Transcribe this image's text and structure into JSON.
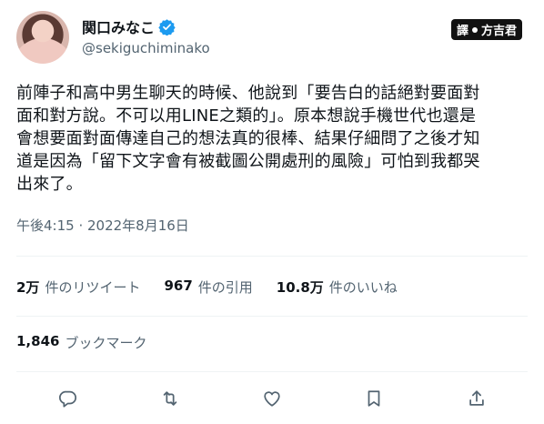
{
  "author": {
    "display_name": "関口みなこ",
    "handle": "@sekiguchiminako"
  },
  "watermark": {
    "left": "譯",
    "right": "方吉君"
  },
  "tweet": {
    "lines": [
      "前陣子和高中男生聊天的時候、他說到「要告白的話絕對要面對",
      "面和對方說。不可以用LINE之類的」。原本想說手機世代也還是",
      "會想要面對面傳達自己的想法真的很棒、結果仔細問了之後才知",
      "道是因為「留下文字會有被截圖公開處刑的風險」可怕到我都哭",
      "出來了。"
    ],
    "timestamp": "午後4:15 · 2022年8月16日"
  },
  "stats": {
    "retweets": {
      "num": "2万",
      "label": "件のリツイート"
    },
    "quotes": {
      "num": "967",
      "label": "件の引用"
    },
    "likes": {
      "num": "10.8万",
      "label": "件のいいね"
    },
    "bookmarks": {
      "num": "1,846",
      "label": "ブックマーク"
    }
  },
  "icons": [
    "reply-icon",
    "retweet-icon",
    "like-icon",
    "bookmark-icon",
    "share-icon"
  ],
  "colors": {
    "verified": "#1d9bf0",
    "muted": "#536471",
    "text": "#0f1419"
  }
}
